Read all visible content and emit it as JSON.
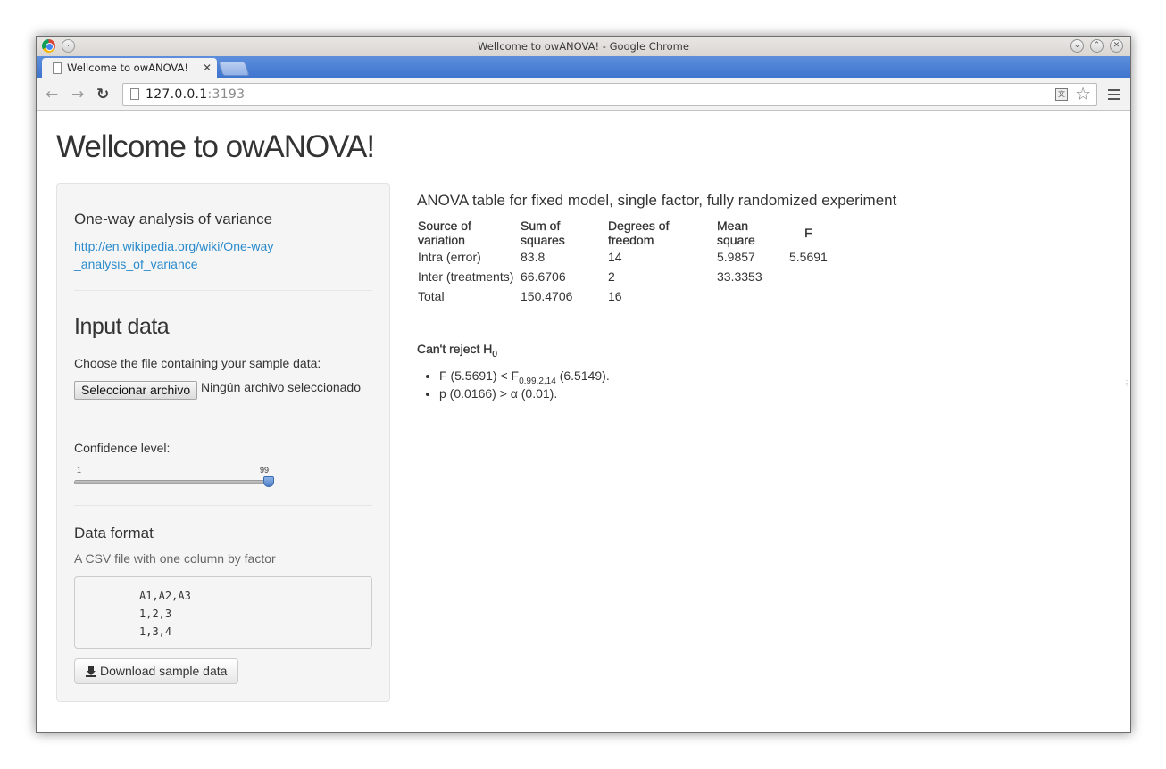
{
  "window": {
    "title": "Wellcome to owANOVA! - Google Chrome",
    "min_glyph": "·",
    "controls": [
      "⌄",
      "⌃",
      "✕"
    ]
  },
  "tab": {
    "title": "Wellcome to owANOVA!",
    "close": "✕"
  },
  "omnibox": {
    "host": "127.0.0.1",
    "port": ":3193",
    "translate": "文"
  },
  "nav": {
    "back": "←",
    "forward": "→",
    "reload": "↻",
    "star": "☆"
  },
  "page": {
    "title": "Wellcome to owANOVA!"
  },
  "sidebar": {
    "about_heading": "One-way analysis of variance",
    "about_link": "http://en.wikipedia.org/wiki/One-way_analysis_of_variance",
    "input_heading": "Input data",
    "file_label": "Choose the file containing your sample data:",
    "file_button": "Seleccionar archivo",
    "file_status": "Ningún archivo seleccionado",
    "confidence_label": "Confidence level:",
    "slider": {
      "min": "1",
      "max": "99",
      "value": 99
    },
    "format_heading": "Data format",
    "format_desc": "A CSV file with one column by factor",
    "sample_lines": [
      "A1,A2,A3",
      "1,2,3",
      "1,3,4"
    ],
    "download_button": "Download sample data"
  },
  "main": {
    "heading": "ANOVA table for fixed model, single factor, fully randomized experiment",
    "table": {
      "headers": [
        "Source of variation",
        "Sum of squares",
        "Degrees of freedom",
        "Mean square",
        "F"
      ],
      "rows": [
        [
          "Intra (error)",
          "83.8",
          "14",
          "5.9857",
          "5.5691"
        ],
        [
          "Inter (treatments)",
          "66.6706",
          "2",
          "33.3353",
          ""
        ],
        [
          "Total",
          "150.4706",
          "16",
          "",
          ""
        ]
      ]
    },
    "verdict": {
      "text": "Can't reject H",
      "sub": "0"
    },
    "bullets": [
      {
        "pre": "F (5.5691) < F",
        "sub": "0.99,2,14",
        "post": " (6.5149)."
      },
      {
        "pre": "p (0.0166) > α (0.01).",
        "sub": "",
        "post": ""
      }
    ]
  }
}
